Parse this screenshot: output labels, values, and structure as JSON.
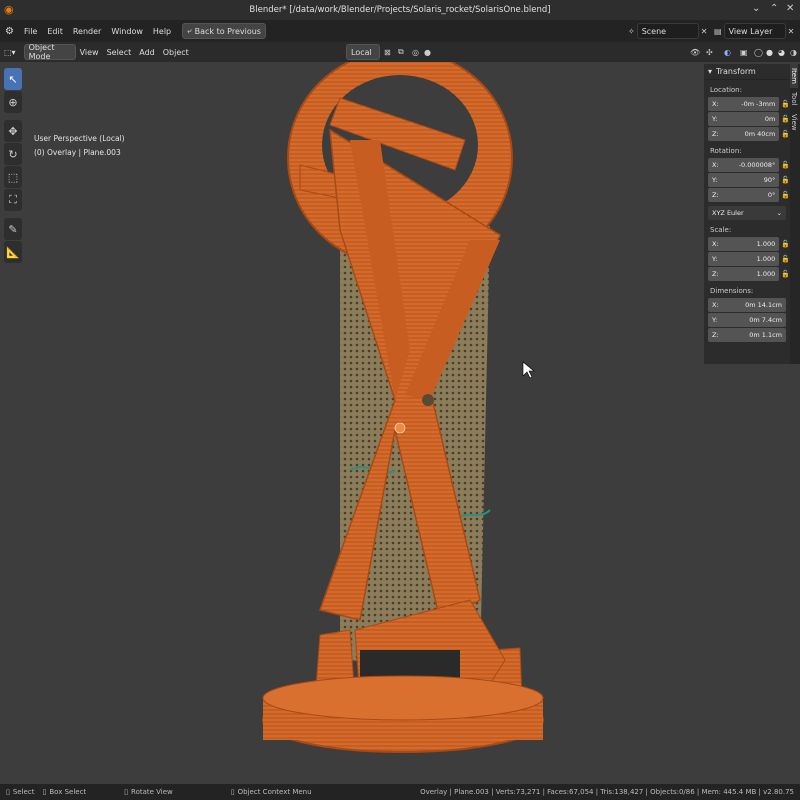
{
  "window": {
    "title": "Blender* [/data/work/Blender/Projects/Solaris_rocket/SolarisOne.blend]"
  },
  "topbar": {
    "menus": [
      "File",
      "Edit",
      "Render",
      "Window",
      "Help"
    ],
    "back_button": "Back to Previous",
    "scene": "Scene",
    "view_layer": "View Layer"
  },
  "header": {
    "mode": "Object Mode",
    "menus": [
      "View",
      "Select",
      "Add",
      "Object"
    ],
    "orientation": "Local"
  },
  "viewport": {
    "perspective": "User Perspective (Local)",
    "object_info": "(0) Overlay | Plane.003"
  },
  "npanel": {
    "title": "Transform",
    "tabs": [
      "Item",
      "Tool",
      "View"
    ],
    "location_label": "Location:",
    "location": [
      {
        "axis": "X:",
        "value": "-0m -3mm"
      },
      {
        "axis": "Y:",
        "value": "0m"
      },
      {
        "axis": "Z:",
        "value": "0m 40cm"
      }
    ],
    "rotation_label": "Rotation:",
    "rotation": [
      {
        "axis": "X:",
        "value": "-0.000008°"
      },
      {
        "axis": "Y:",
        "value": "90°"
      },
      {
        "axis": "Z:",
        "value": "0°"
      }
    ],
    "rotation_mode": "XYZ Euler",
    "scale_label": "Scale:",
    "scale": [
      {
        "axis": "X:",
        "value": "1.000"
      },
      {
        "axis": "Y:",
        "value": "1.000"
      },
      {
        "axis": "Z:",
        "value": "1.000"
      }
    ],
    "dimensions_label": "Dimensions:",
    "dimensions": [
      {
        "axis": "X:",
        "value": "0m 14.1cm"
      },
      {
        "axis": "Y:",
        "value": "0m 7.4cm"
      },
      {
        "axis": "Z:",
        "value": "0m 1.1cm"
      }
    ]
  },
  "statusbar": {
    "select": "Select",
    "box_select": "Box Select",
    "rotate_view": "Rotate View",
    "context_menu": "Object Context Menu",
    "stats": "Overlay | Plane.003 | Verts:73,271 | Faces:67,054 | Tris:138,427 | Objects:0/86 | Mem: 445.4 MB | v2.80.75"
  },
  "colors": {
    "accent": "#4772b3",
    "model_orange": "#d96a2a",
    "board": "#8a7a5a"
  }
}
